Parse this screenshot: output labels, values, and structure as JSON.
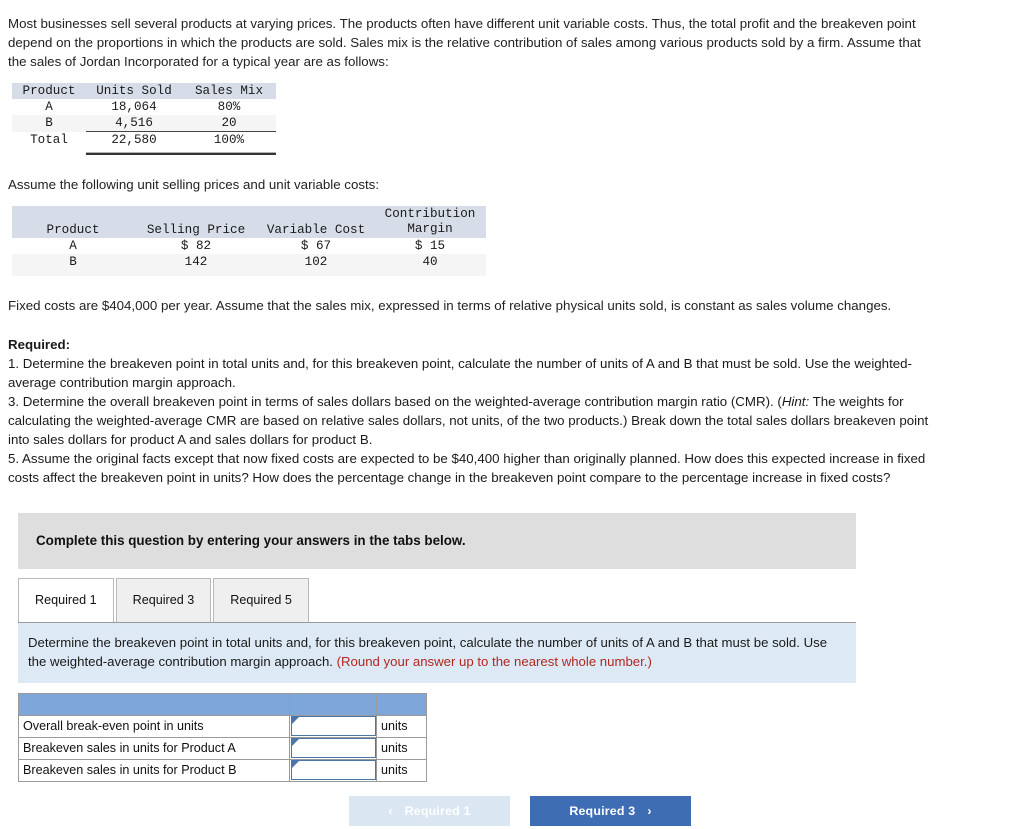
{
  "intro": {
    "paragraph": "Most businesses sell several products at varying prices. The products often have different unit variable costs. Thus, the total profit and the breakeven point depend on the proportions in which the products are sold. Sales mix is the relative contribution of sales among various products sold by a firm. Assume that the sales of Jordan Incorporated for a typical year are as follows:",
    "assume_line": "Assume the following unit selling prices and unit variable costs:",
    "fixed_costs_line": "Fixed costs are $404,000 per year. Assume that the sales mix, expressed in terms of relative physical units sold, is constant as sales volume changes."
  },
  "sales_mix_table": {
    "headers": [
      "Product",
      "Units Sold",
      "Sales Mix"
    ],
    "rows": [
      {
        "product": "A",
        "units_sold": "18,064",
        "sales_mix": "80%"
      },
      {
        "product": "B",
        "units_sold": "4,516",
        "sales_mix": "20"
      }
    ],
    "total": {
      "product": "Total",
      "units_sold": "22,580",
      "sales_mix": "100%"
    }
  },
  "price_table": {
    "headers": [
      "Product",
      "Selling Price",
      "Variable Cost",
      "Contribution Margin"
    ],
    "header_cm_line1": "Contribution",
    "header_cm_line2": "Margin",
    "rows": [
      {
        "product": "A",
        "selling_price": "$ 82",
        "variable_cost": "$ 67",
        "contribution_margin": "$ 15"
      },
      {
        "product": "B",
        "selling_price": "142",
        "variable_cost": "102",
        "contribution_margin": "40"
      }
    ]
  },
  "required": {
    "title": "Required:",
    "item1": "1. Determine the breakeven point in total units and, for this breakeven point, calculate the number of units of A and B that must be sold. Use the weighted-average contribution margin approach.",
    "item3_a": "3. Determine the overall breakeven point in terms of sales dollars based on the weighted-average contribution margin ratio (CMR). (",
    "item3_hint": "Hint:",
    "item3_b": " The weights for calculating the weighted-average CMR are based on relative sales dollars, not units, of the two products.) Break down the total sales dollars breakeven point into sales dollars for product A and sales dollars for product B.",
    "item5": "5. Assume the original facts except that now fixed costs are expected to be $40,400 higher than originally planned. How does this expected increase in fixed costs affect the breakeven point in units? How does the percentage change in the breakeven point compare to the percentage increase in fixed costs?"
  },
  "banner": {
    "text": "Complete this question by entering your answers in the tabs below."
  },
  "tabs": [
    {
      "label": "Required 1",
      "active": true
    },
    {
      "label": "Required 3",
      "active": false
    },
    {
      "label": "Required 5",
      "active": false
    }
  ],
  "instruction": {
    "main": "Determine the breakeven point in total units and, for this breakeven point, calculate the number of units of A and B that must be sold. Use the weighted-average contribution margin approach.",
    "note": "(Round your answer up to the nearest whole number.)"
  },
  "answer_table": {
    "rows": [
      {
        "label": "Overall break-even point in units",
        "value": "",
        "unit": "units"
      },
      {
        "label": "Breakeven sales in units for Product A",
        "value": "",
        "unit": "units"
      },
      {
        "label": "Breakeven sales in units for Product B",
        "value": "",
        "unit": "units"
      }
    ]
  },
  "nav": {
    "prev_label": "Required 1",
    "next_label": "Required 3",
    "prev_chevron": "‹",
    "next_chevron": "›"
  },
  "colors": {
    "accent_blue": "#3f6db3",
    "header_blue": "#7ea6d9",
    "instruction_blue": "#ddeaf6",
    "banner_gray": "#dedede",
    "note_red": "#b3271f",
    "input_border": "#4a76a8"
  }
}
